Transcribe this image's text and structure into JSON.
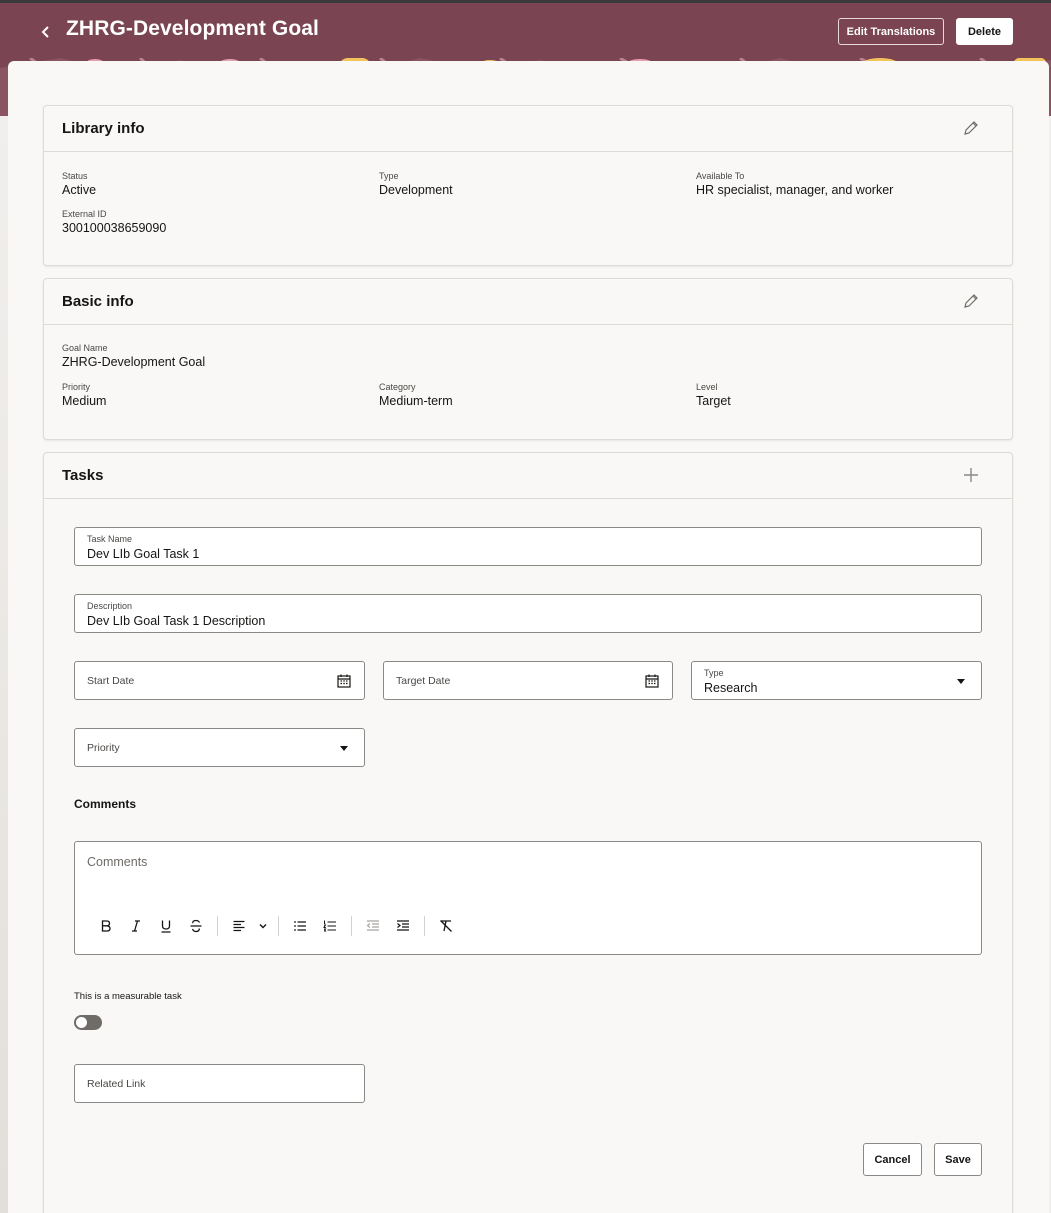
{
  "header": {
    "title": "ZHRG-Development Goal",
    "edit_translations_label": "Edit Translations",
    "delete_label": "Delete"
  },
  "library_info": {
    "title": "Library info",
    "status_label": "Status",
    "status_value": "Active",
    "type_label": "Type",
    "type_value": "Development",
    "available_label": "Available To",
    "available_value": "HR specialist, manager, and worker",
    "external_id_label": "External ID",
    "external_id_value": "300100038659090"
  },
  "basic_info": {
    "title": "Basic info",
    "goal_name_label": "Goal Name",
    "goal_name_value": "ZHRG-Development Goal",
    "priority_label": "Priority",
    "priority_value": "Medium",
    "category_label": "Category",
    "category_value": "Medium-term",
    "level_label": "Level",
    "level_value": "Target"
  },
  "tasks": {
    "title": "Tasks",
    "task_name_label": "Task Name",
    "task_name_value": "Dev LIb Goal Task 1",
    "description_label": "Description",
    "description_value": "Dev LIb Goal Task 1 Description",
    "start_date_placeholder": "Start Date",
    "target_date_placeholder": "Target Date",
    "type_label": "Type",
    "type_value": "Research",
    "priority_placeholder": "Priority",
    "comments_heading": "Comments",
    "comments_placeholder": "Comments",
    "measurable_label": "This is a measurable task",
    "related_link_placeholder": "Related Link",
    "cancel_label": "Cancel",
    "save_label": "Save"
  },
  "toolbar_icons": [
    "bold-icon",
    "italic-icon",
    "underline-icon",
    "strikethrough-icon",
    "align-icon",
    "chevron-down-icon",
    "bullet-list-icon",
    "numbered-list-icon",
    "outdent-icon",
    "indent-icon",
    "clear-format-icon"
  ],
  "colors": {
    "banner": "#7a4452",
    "page_bg": "#f9f8f6",
    "border": "#dedbd7",
    "input_border": "#8b8985"
  }
}
